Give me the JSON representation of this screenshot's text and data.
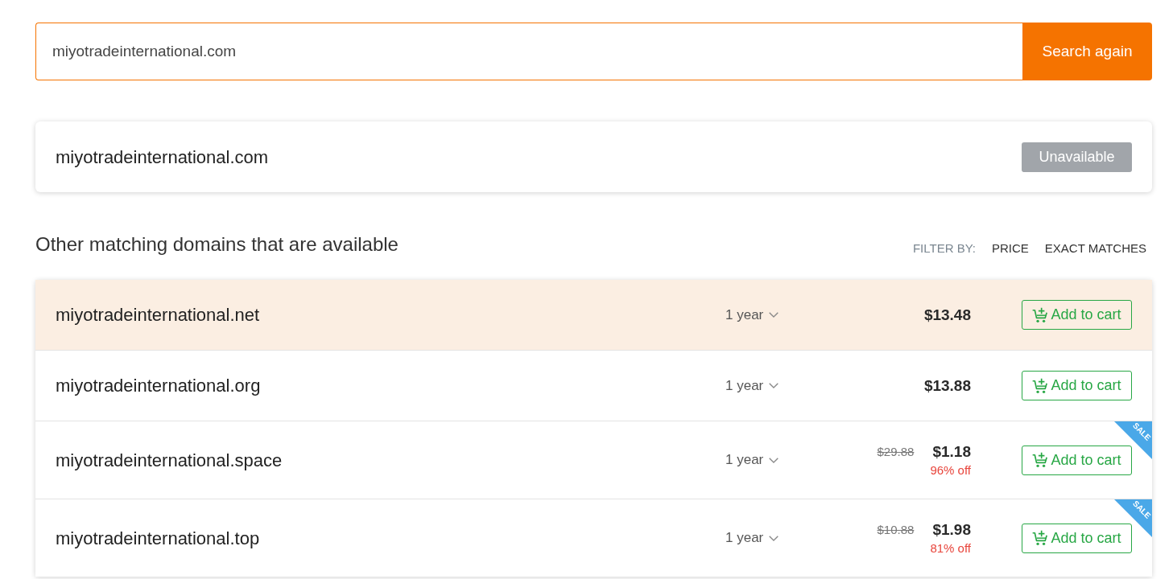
{
  "search": {
    "value": "miyotradeinternational.com",
    "button": "Search again"
  },
  "lookup": {
    "domain": "miyotradeinternational.com",
    "status": "Unavailable",
    "available": false
  },
  "other_matches": {
    "heading": "Other matching domains that are available",
    "filter_label": "FILTER BY:",
    "filters": [
      "PRICE",
      "EXACT MATCHES"
    ]
  },
  "domains": [
    {
      "name": "miyotradeinternational.net",
      "term": "1 year",
      "price": "$13.48",
      "highlighted": true,
      "button": "Add to cart"
    },
    {
      "name": "miyotradeinternational.org",
      "term": "1 year",
      "price": "$13.88",
      "highlighted": false,
      "button": "Add to cart"
    },
    {
      "name": "miyotradeinternational.space",
      "term": "1 year",
      "old_price": "$29.88",
      "price": "$1.18",
      "discount": "96% off",
      "ribbon": "SALE",
      "highlighted": false,
      "button": "Add to cart"
    },
    {
      "name": "miyotradeinternational.top",
      "term": "1 year",
      "old_price": "$10.88",
      "price": "$1.98",
      "discount": "81% off",
      "ribbon": "SALE",
      "highlighted": false,
      "button": "Add to cart"
    }
  ]
}
